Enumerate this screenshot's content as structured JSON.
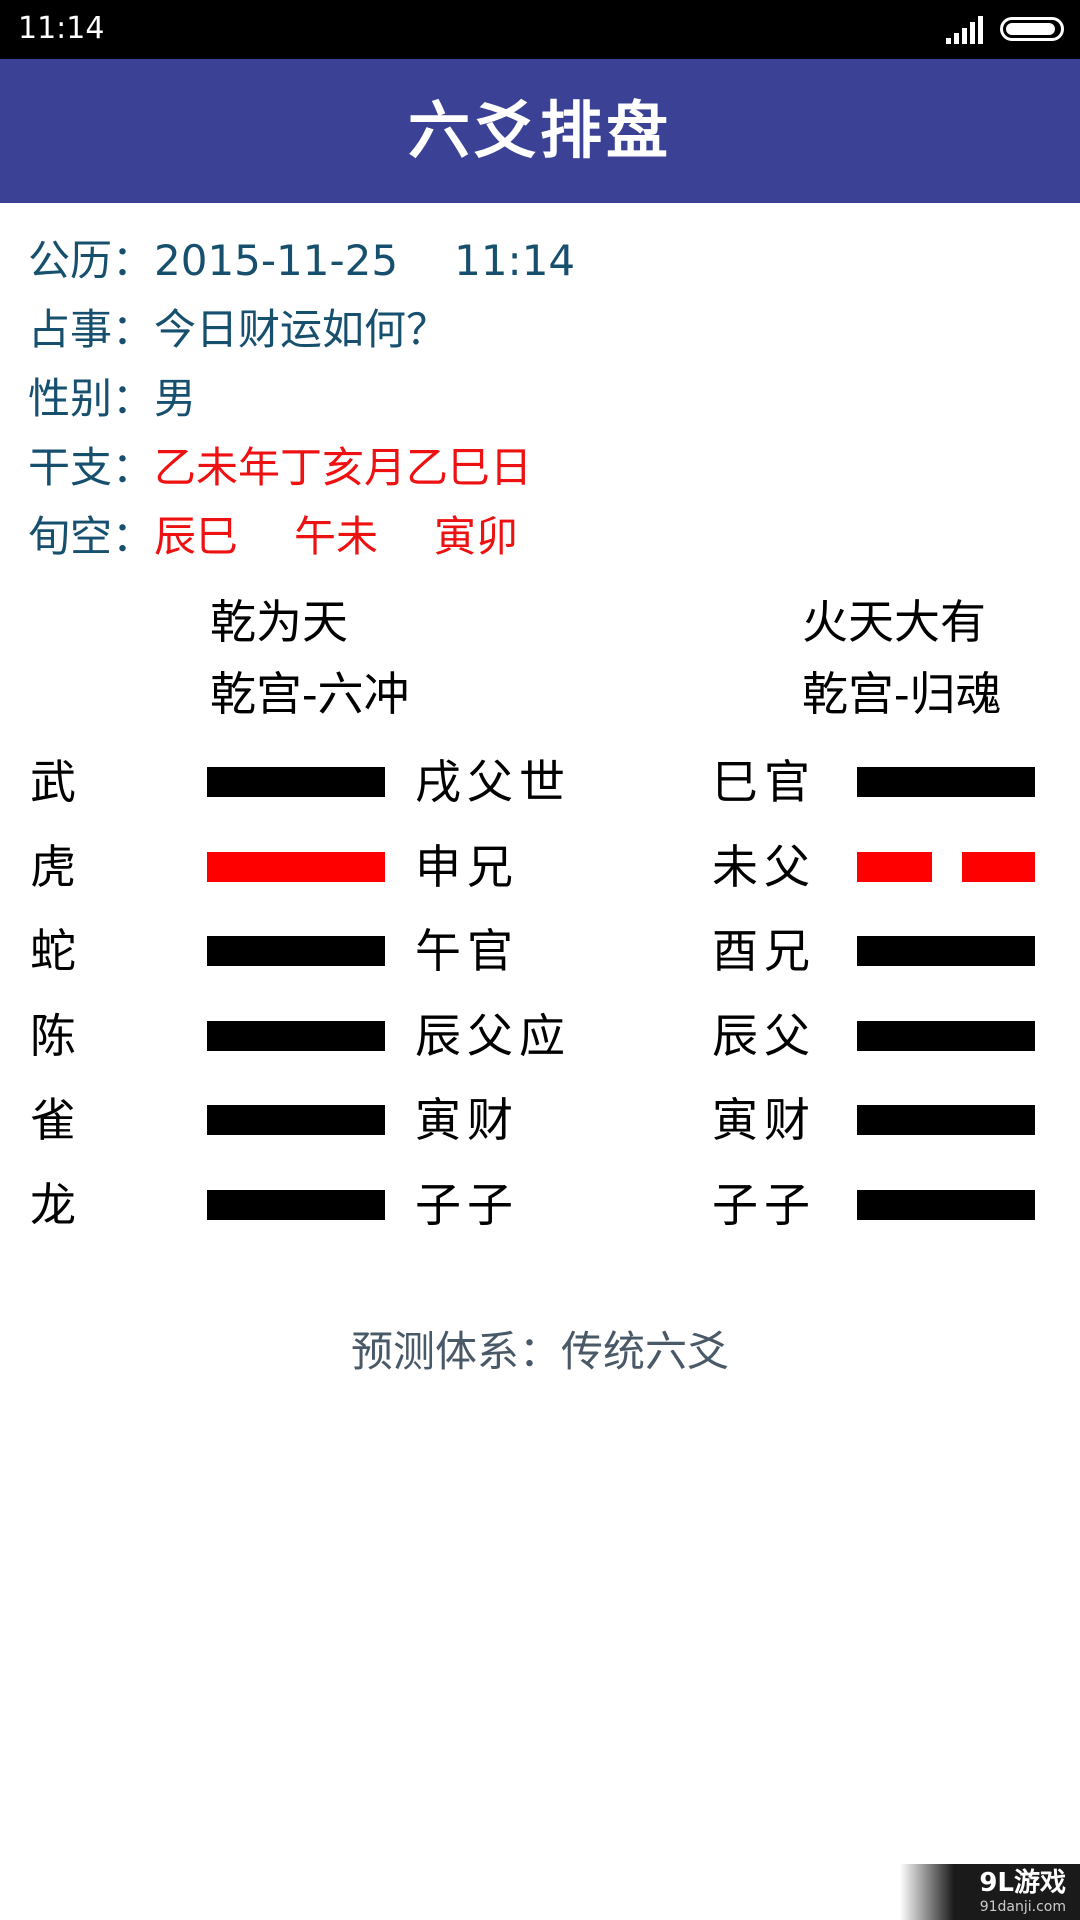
{
  "status_bar": {
    "time": "11:14",
    "battery_level": 0.95
  },
  "header": {
    "title": "六爻排盘"
  },
  "info": {
    "gregorian": {
      "label": "公历：",
      "date": "2015-11-25",
      "time": "11:14"
    },
    "matter": {
      "label": "占事：",
      "value": "今日财运如何？"
    },
    "gender": {
      "label": "性别：",
      "value": "男"
    },
    "ganzhi": {
      "label": "干支：",
      "value": "乙未年丁亥月乙巳日"
    },
    "xunkong": {
      "label": "旬空：",
      "values": [
        "辰巳",
        "午未",
        "寅卯"
      ]
    }
  },
  "hexagrams": {
    "main": {
      "name": "乾为天",
      "palace": "乾宫-六冲"
    },
    "changed": {
      "name": "火天大有",
      "palace": "乾宫-归魂"
    }
  },
  "rows": [
    {
      "spirit": "武",
      "main_line": "yang",
      "main_moving": false,
      "main_label": "戌父世",
      "changed_label": "巳官",
      "changed_line": "yang"
    },
    {
      "spirit": "虎",
      "main_line": "yang",
      "main_moving": true,
      "main_label": "申兄",
      "changed_label": "未父",
      "changed_line": "yin"
    },
    {
      "spirit": "蛇",
      "main_line": "yang",
      "main_moving": false,
      "main_label": "午官",
      "changed_label": "酉兄",
      "changed_line": "yang"
    },
    {
      "spirit": "陈",
      "main_line": "yang",
      "main_moving": false,
      "main_label": "辰父应",
      "changed_label": "辰父",
      "changed_line": "yang"
    },
    {
      "spirit": "雀",
      "main_line": "yang",
      "main_moving": false,
      "main_label": "寅财",
      "changed_label": "寅财",
      "changed_line": "yang"
    },
    {
      "spirit": "龙",
      "main_line": "yang",
      "main_moving": false,
      "main_label": "子子",
      "changed_label": "子子",
      "changed_line": "yang"
    }
  ],
  "footer": {
    "system": "预测体系：传统六爻"
  },
  "watermark": {
    "main": "9L游戏",
    "sub": "91danji.com"
  },
  "colors": {
    "title_bar": "#3b4295",
    "info_text": "#17506e",
    "highlight_red": "#ee1111",
    "line_black": "#000000",
    "line_moving": "#ff0000",
    "footer_text": "#4a5968"
  }
}
